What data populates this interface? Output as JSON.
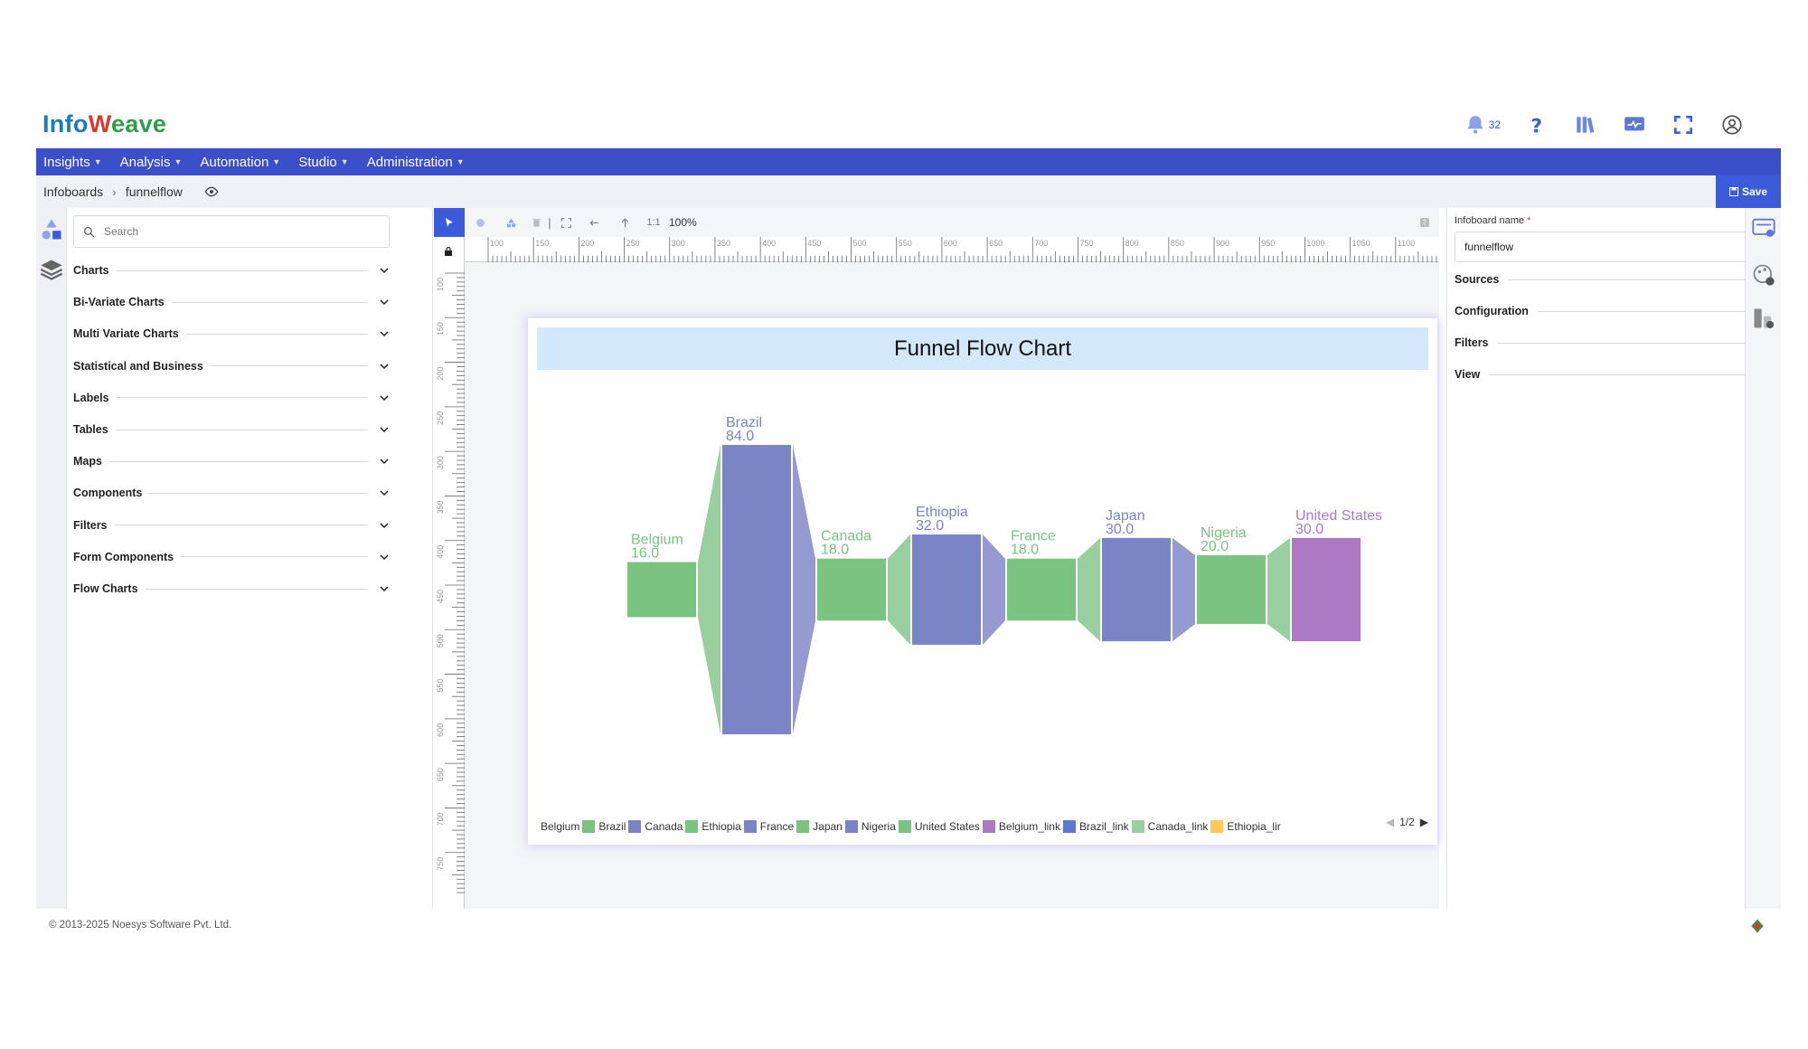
{
  "app": {
    "logo_text_start": "Info",
    "logo_text_end": "eave",
    "notification_count": "32"
  },
  "nav": [
    {
      "label": "Insights"
    },
    {
      "label": "Analysis"
    },
    {
      "label": "Automation"
    },
    {
      "label": "Studio"
    },
    {
      "label": "Administration"
    }
  ],
  "breadcrumb": {
    "root": "Infoboards",
    "current": "funnelflow"
  },
  "save_label": "Save",
  "search": {
    "placeholder": "Search"
  },
  "component_groups": [
    {
      "label": "Charts"
    },
    {
      "label": "Bi-Variate Charts"
    },
    {
      "label": "Multi Variate Charts"
    },
    {
      "label": "Statistical and Business"
    },
    {
      "label": "Labels"
    },
    {
      "label": "Tables"
    },
    {
      "label": "Maps"
    },
    {
      "label": "Components"
    },
    {
      "label": "Filters"
    },
    {
      "label": "Form Components"
    },
    {
      "label": "Flow Charts"
    }
  ],
  "toolbar": {
    "ratio_label": "1:1",
    "zoom": "100%"
  },
  "ruler": {
    "top_ticks": [
      "100",
      "150",
      "200",
      "250",
      "300",
      "350",
      "400",
      "450",
      "500",
      "550",
      "600",
      "650",
      "700",
      "750",
      "800",
      "850",
      "900",
      "950",
      "1000",
      "1050",
      "1100"
    ],
    "left_ticks": [
      "100",
      "150",
      "200",
      "250",
      "300",
      "350",
      "400",
      "450",
      "500",
      "550",
      "600",
      "650",
      "700",
      "750"
    ]
  },
  "chart_data": {
    "type": "funnel-flow",
    "title": "Funnel Flow Chart",
    "categories": [
      "Belgium",
      "Brazil",
      "Canada",
      "Ethiopia",
      "France",
      "Japan",
      "Nigeria",
      "United States"
    ],
    "values": [
      16.0,
      84.0,
      18.0,
      32.0,
      18.0,
      30.0,
      20.0,
      30.0
    ],
    "value_labels": [
      "16.0",
      "84.0",
      "18.0",
      "32.0",
      "18.0",
      "30.0",
      "20.0",
      "30.0"
    ],
    "colors": [
      "#7ac381",
      "#7b84c4",
      "#7ac381",
      "#7b84c4",
      "#7ac381",
      "#7b84c4",
      "#7ac381",
      "#ae79c3"
    ],
    "link_colors": [
      "#99cf9e",
      "#959bd0",
      "#99cf9e",
      "#959bd0",
      "#99cf9e",
      "#959bd0",
      "#99cf9e"
    ],
    "legend": [
      {
        "name": "Belgium",
        "color": "#7ac381"
      },
      {
        "name": "Brazil",
        "color": "#7b84c4"
      },
      {
        "name": "Canada",
        "color": "#7ac381"
      },
      {
        "name": "Ethiopia",
        "color": "#7b84c4"
      },
      {
        "name": "France",
        "color": "#7ac381"
      },
      {
        "name": "Japan",
        "color": "#7b84c4"
      },
      {
        "name": "Nigeria",
        "color": "#7ac381"
      },
      {
        "name": "United States",
        "color": "#ae79c3"
      },
      {
        "name": "Belgium_link",
        "color": "#5f79d2"
      },
      {
        "name": "Brazil_link",
        "color": "#99cf9e"
      },
      {
        "name": "Canada_link",
        "color": "#ffc857"
      },
      {
        "name": "Ethiopia_lir",
        "color": "#ffffff"
      }
    ],
    "legend_page": "1/2",
    "legend_position": "bottom"
  },
  "config": {
    "board_name_label": "Infoboard name",
    "board_name_required": "*",
    "board_name_value": "funnelflow",
    "sections": [
      {
        "label": "Sources"
      },
      {
        "label": "Configuration"
      },
      {
        "label": "Filters"
      },
      {
        "label": "View"
      }
    ]
  },
  "footer": {
    "copyright": "© 2013-2025 Noesys Software Pvt. Ltd."
  },
  "colors": {
    "nav_bg": "#3b4fc8",
    "accent": "#3b5bdb"
  }
}
